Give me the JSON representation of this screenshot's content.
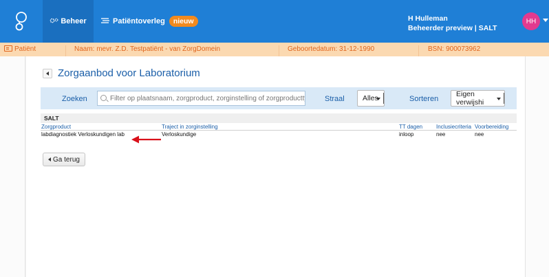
{
  "topbar": {
    "nav": [
      {
        "label": "Beheer",
        "icon": "gears-icon"
      },
      {
        "label": "Patiëntoverleg",
        "icon": "chat-icon",
        "badge": "nieuw"
      }
    ],
    "user": {
      "name": "H Hulleman",
      "role": "Beheerder preview | SALT",
      "initials": "HH"
    }
  },
  "patient": {
    "tab_label": "Patiënt",
    "name": "Naam: mevr. Z.D. Testpatiënt - van ZorgDomein",
    "dob": "Geboortedatum: 31-12-1990",
    "bsn": "BSN: 900073962"
  },
  "page": {
    "title": "Zorgaanbod voor Laboratorium",
    "search": {
      "label": "Zoeken",
      "placeholder": "Filter op plaatsnaam, zorgproduct, zorginstelling of zorgproducttype"
    },
    "straal": {
      "label": "Straal",
      "value": "Alles"
    },
    "sort": {
      "label": "Sorteren",
      "value": "Eigen verwijshi"
    }
  },
  "results": {
    "group": "SALT",
    "columns": [
      "Zorgproduct",
      "Traject in zorginstelling",
      "TT dagen",
      "Inclusiecriteria",
      "Voorbereiding"
    ],
    "rows": [
      {
        "product": "labdiagnostiek Verloskundigen lab",
        "traject": "Verloskundige",
        "tt": "inloop",
        "inclusie": "nee",
        "voorbereiding": "nee"
      }
    ]
  },
  "buttons": {
    "back": "Ga terug"
  },
  "colors": {
    "topbar": "#1f7fd6",
    "accent_orange": "#f28a1e",
    "patient_bar": "#fbd9b1",
    "link_blue": "#1a5ea8",
    "annotation_red": "#d9101a"
  }
}
